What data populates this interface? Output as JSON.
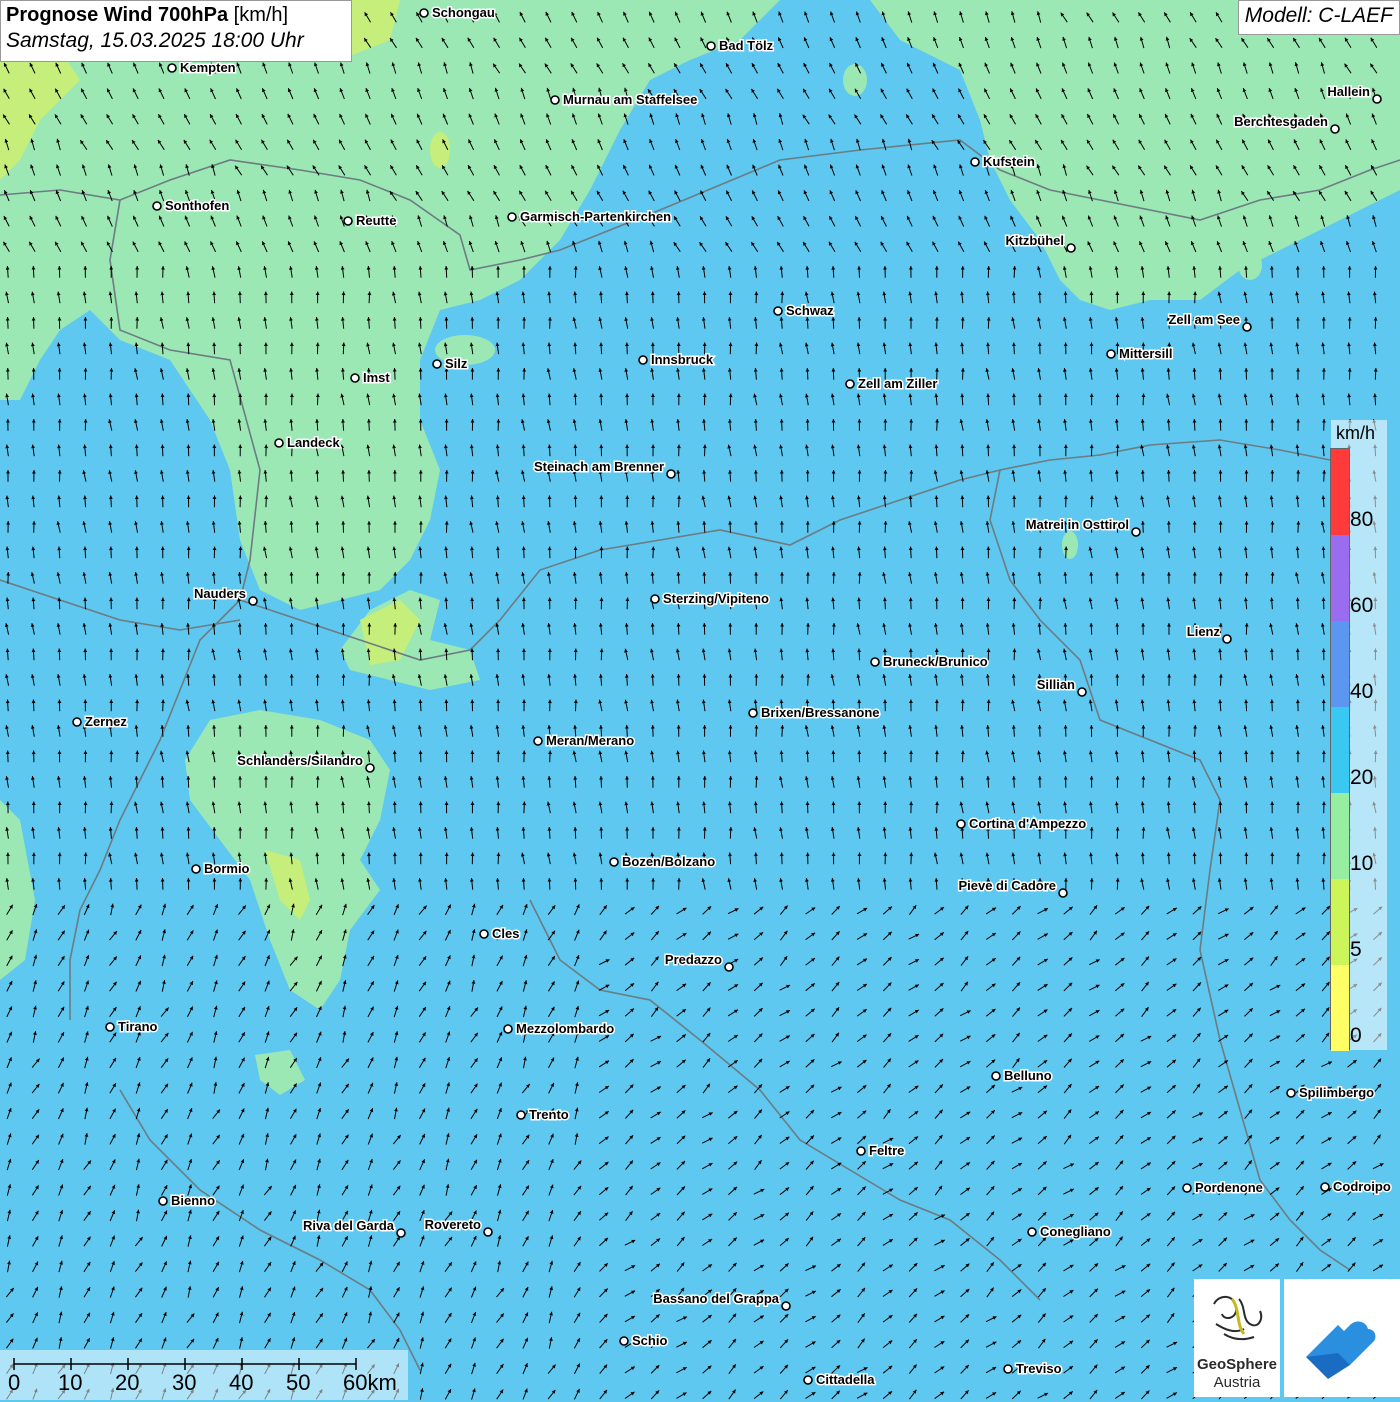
{
  "header": {
    "title_bold": "Prognose Wind 700hPa",
    "title_unit": "[km/h]",
    "datetime": "Samstag, 15.03.2025 18:00 Uhr",
    "model": "Modell: C-LAEF"
  },
  "legend": {
    "unit": "km/h",
    "ticks": [
      "0",
      "5",
      "10",
      "20",
      "40",
      "60",
      "80"
    ],
    "colors": [
      "#ffff66",
      "#ccf55a",
      "#96eea0",
      "#38c8f2",
      "#5b96f0",
      "#9a6cf0",
      "#ff3a3a"
    ]
  },
  "colors": {
    "wind_strong": "#5ec8f0",
    "wind_medium": "#9be8b5",
    "wind_light": "#c5ef7a",
    "border": "#6d7b82"
  },
  "cities": [
    {
      "name": "Schongau"
    },
    {
      "name": "Bad Tölz"
    },
    {
      "name": "Kempten"
    },
    {
      "name": "Murnau am Staffelsee"
    },
    {
      "name": "Hallein"
    },
    {
      "name": "Berchtesgaden"
    },
    {
      "name": "Kufstein"
    },
    {
      "name": "Sonthofen"
    },
    {
      "name": "Reutte"
    },
    {
      "name": "Garmisch-Partenkirchen"
    },
    {
      "name": "Kitzbühel"
    },
    {
      "name": "Schwaz"
    },
    {
      "name": "Zell am See"
    },
    {
      "name": "Mittersill"
    },
    {
      "name": "Silz"
    },
    {
      "name": "Innsbruck"
    },
    {
      "name": "Imst"
    },
    {
      "name": "Zell am Ziller"
    },
    {
      "name": "Landeck"
    },
    {
      "name": "Steinach am Brenner"
    },
    {
      "name": "Matrei in Osttirol"
    },
    {
      "name": "Nauders"
    },
    {
      "name": "Sterzing/Vipiteno"
    },
    {
      "name": "Lienz"
    },
    {
      "name": "Bruneck/Brunico"
    },
    {
      "name": "Sillian"
    },
    {
      "name": "Zernez"
    },
    {
      "name": "Brixen/Bressanone"
    },
    {
      "name": "Meran/Merano"
    },
    {
      "name": "Schlanders/Silandro"
    },
    {
      "name": "Cortina d'Ampezzo"
    },
    {
      "name": "Bozen/Bolzano"
    },
    {
      "name": "Bormio"
    },
    {
      "name": "Pieve di Cadore"
    },
    {
      "name": "Cles"
    },
    {
      "name": "Predazzo"
    },
    {
      "name": "Tirano"
    },
    {
      "name": "Mezzolombardo"
    },
    {
      "name": "Belluno"
    },
    {
      "name": "Spilimbergo"
    },
    {
      "name": "Trento"
    },
    {
      "name": "Feltre"
    },
    {
      "name": "Pordenone"
    },
    {
      "name": "Codroipo"
    },
    {
      "name": "Bienno"
    },
    {
      "name": "Riva del Garda"
    },
    {
      "name": "Rovereto"
    },
    {
      "name": "Conegliano"
    },
    {
      "name": "Bassano del Grappa"
    },
    {
      "name": "Schio"
    },
    {
      "name": "Treviso"
    },
    {
      "name": "Cittadella"
    }
  ],
  "scale": {
    "ticks": [
      "0",
      "10",
      "20",
      "30",
      "40",
      "50",
      "60km"
    ]
  },
  "logo": {
    "brand_bold": "GeoSphere",
    "brand_sub": "Austria"
  }
}
